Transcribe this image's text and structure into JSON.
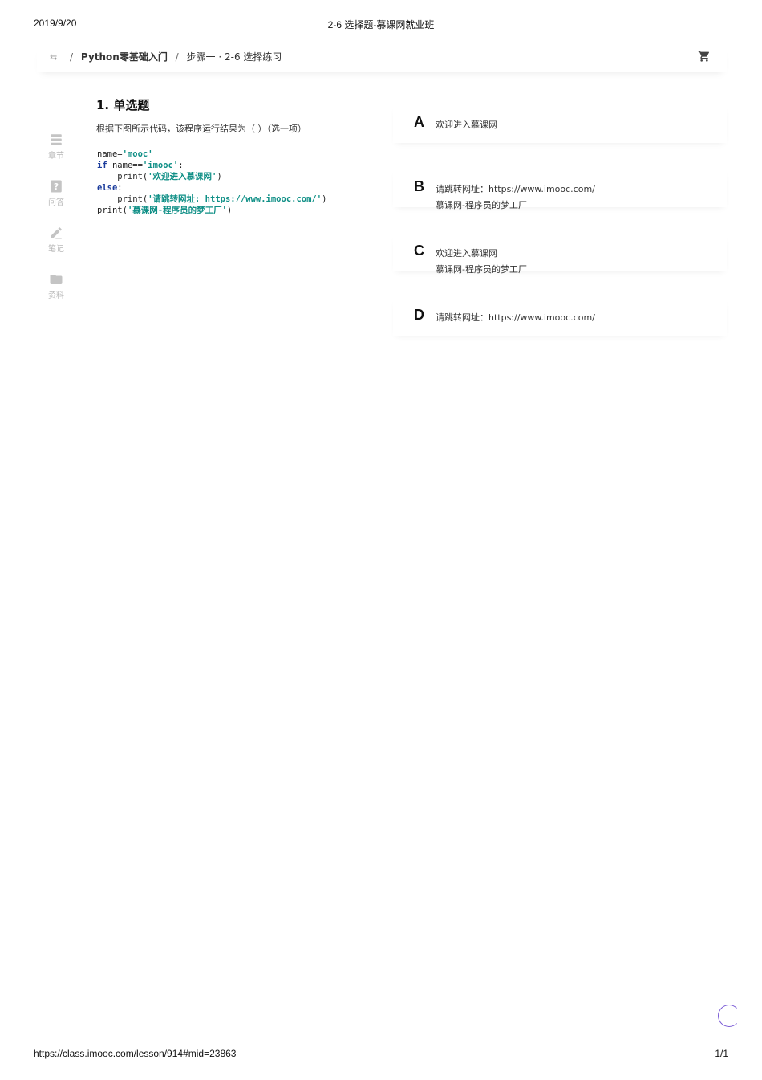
{
  "print": {
    "date": "2019/9/20",
    "title": "2-6 选择题-慕课网就业班",
    "url": "https://class.imooc.com/lesson/914#mid=23863",
    "page": "1/1"
  },
  "breadcrumb": {
    "separator": "/",
    "course": "Python零基础入门",
    "lesson": "步骤一 · 2-6 选择练习"
  },
  "sidebar": {
    "items": [
      {
        "label": "章节",
        "icon": "chapter-icon"
      },
      {
        "label": "问答",
        "icon": "question-icon"
      },
      {
        "label": "笔记",
        "icon": "note-pencil-icon"
      },
      {
        "label": "资料",
        "icon": "folder-icon"
      }
    ]
  },
  "question": {
    "title": "1. 单选题",
    "description": "根据下图所示代码，该程序运行结果为（ ）（选一项）",
    "code": {
      "l1": "name=",
      "l1s": "'mooc'",
      "l2k": "if",
      "l2": " name==",
      "l2s": "'imooc'",
      "l2e": ":",
      "l3": "    print(",
      "l3s": "'欢迎进入慕课网'",
      "l3e": ")",
      "l4k": "else",
      "l4e": ":",
      "l5": "    print(",
      "l5s": "'请跳转网址: https://www.imooc.com/'",
      "l5e": ")",
      "l6": "print(",
      "l6s": "'慕课网-程序员的梦工厂'",
      "l6e": ")"
    }
  },
  "options": [
    {
      "letter": "A",
      "line1": "欢迎进入慕课网",
      "line2": ""
    },
    {
      "letter": "B",
      "line1": "请跳转网址：https://www.imooc.com/",
      "line2": "慕课网-程序员的梦工厂"
    },
    {
      "letter": "C",
      "line1": "欢迎进入慕课网",
      "line2": "慕课网-程序员的梦工厂"
    },
    {
      "letter": "D",
      "line1": "请跳转网址：https://www.imooc.com/",
      "line2": ""
    }
  ]
}
